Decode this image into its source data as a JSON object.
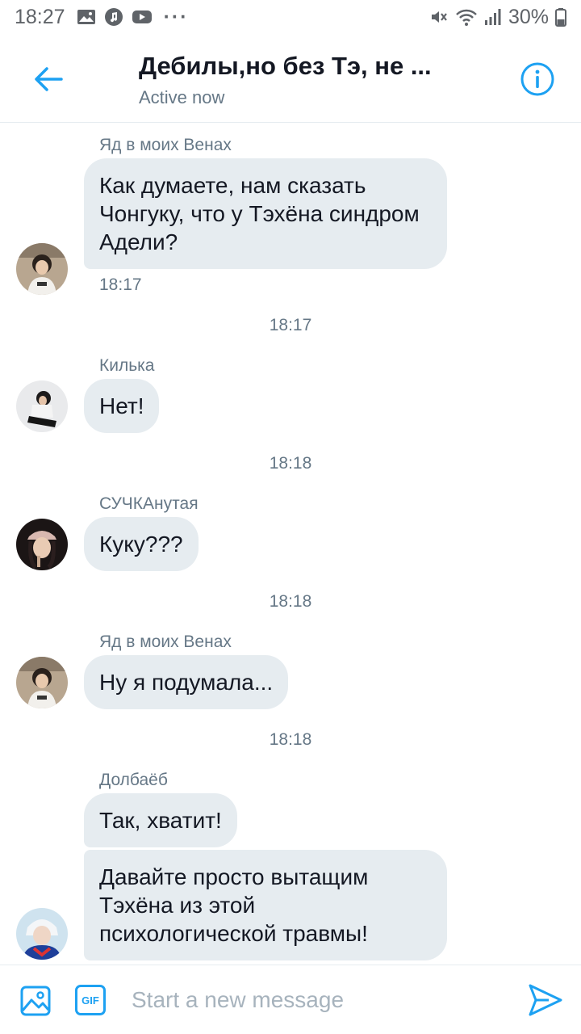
{
  "status_bar": {
    "time": "18:27",
    "battery": "30%"
  },
  "header": {
    "title": "Дебилы,но без Тэ, не ...",
    "status": "Active now"
  },
  "messages": [
    {
      "sender": "Яд в моих Венах",
      "bubbles": [
        "Как думаете, нам сказать Чонгуку, что у Тэхёна синдром Адели?"
      ],
      "time": "18:17"
    },
    {
      "divider_time": "18:17"
    },
    {
      "sender": "Килька",
      "bubbles": [
        "Нет!"
      ]
    },
    {
      "divider_time": "18:18"
    },
    {
      "sender": "СУЧКАнутая",
      "bubbles": [
        "Куку???"
      ]
    },
    {
      "divider_time": "18:18"
    },
    {
      "sender": "Яд в моих Венах",
      "bubbles": [
        "Ну я подумала..."
      ]
    },
    {
      "divider_time": "18:18"
    },
    {
      "sender": "Долбаёб",
      "bubbles": [
        "Так, хватит!",
        "Давайте просто вытащим Тэхёна из этой психологической травмы!"
      ]
    }
  ],
  "compose": {
    "placeholder": "Start a new message",
    "gif_label": "GIF"
  },
  "colors": {
    "accent": "#1da1f2",
    "bubble": "#e6ecf0",
    "meta_text": "#657786"
  }
}
